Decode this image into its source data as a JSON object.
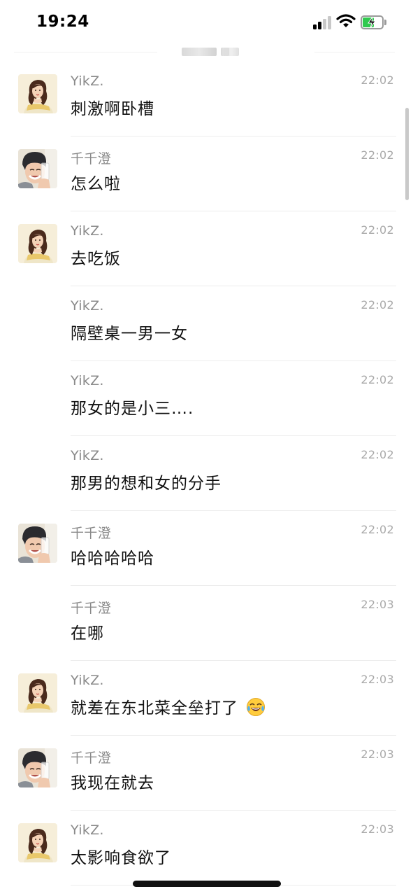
{
  "status_bar": {
    "time": "19:24",
    "icons": [
      "signal-icon",
      "wifi-icon",
      "battery-charging-icon"
    ],
    "battery_color": "#30c94e"
  },
  "chat": {
    "messages": [
      {
        "sender": "YikZ.",
        "time": "22:02",
        "text": "刺激啊卧槽",
        "avatar": "belle"
      },
      {
        "sender": "千千澄",
        "time": "22:02",
        "text": "怎么啦",
        "avatar": "photo"
      },
      {
        "sender": "YikZ.",
        "time": "22:02",
        "text": "去吃饭",
        "avatar": "belle"
      },
      {
        "sender": "YikZ.",
        "time": "22:02",
        "text": "隔壁桌一男一女",
        "avatar": null
      },
      {
        "sender": "YikZ.",
        "time": "22:02",
        "text": "那女的是小三….",
        "avatar": null
      },
      {
        "sender": "YikZ.",
        "time": "22:02",
        "text": "那男的想和女的分手",
        "avatar": null
      },
      {
        "sender": "千千澄",
        "time": "22:02",
        "text": "哈哈哈哈哈",
        "avatar": "photo"
      },
      {
        "sender": "千千澄",
        "time": "22:03",
        "text": "在哪",
        "avatar": null
      },
      {
        "sender": "YikZ.",
        "time": "22:03",
        "text": "就差在东北菜全垒打了",
        "avatar": "belle",
        "emoji": "laughing-crying-emoji"
      },
      {
        "sender": "千千澄",
        "time": "22:03",
        "text": "我现在就去",
        "avatar": "photo"
      },
      {
        "sender": "YikZ.",
        "time": "22:03",
        "text": "太影响食欲了",
        "avatar": "belle"
      }
    ]
  }
}
